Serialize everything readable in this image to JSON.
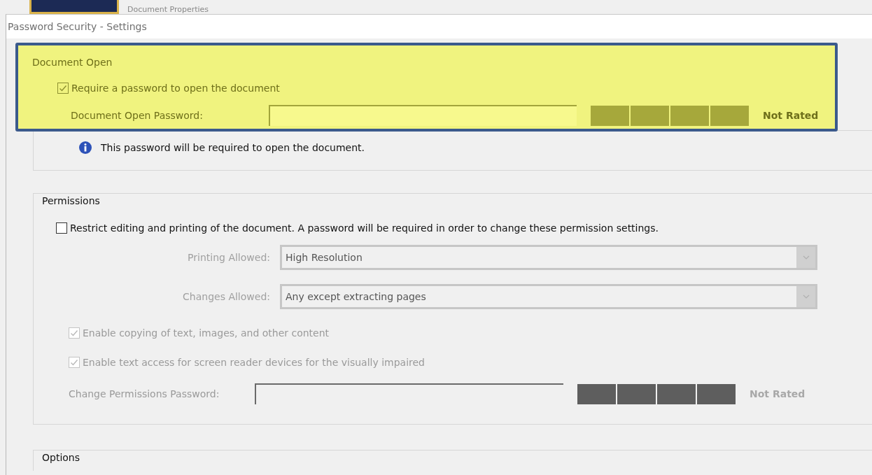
{
  "background_window": {
    "title": "Document Properties"
  },
  "dialog": {
    "title": "Password Security - Settings"
  },
  "document_open": {
    "heading": "Document Open",
    "highlighted": true,
    "require_password": {
      "label": "Require a password to open the document",
      "checked": true,
      "disabled": false
    },
    "password": {
      "label": "Document Open Password:",
      "rating": "Not Rated",
      "disabled": false
    },
    "info": "This password will be required to open the document."
  },
  "permissions": {
    "heading": "Permissions",
    "restrict": {
      "label": "Restrict editing and printing of the document. A password will be required in order to change these permission settings.",
      "checked": false,
      "disabled": false
    },
    "dropdowns": [
      {
        "label": "Printing Allowed:",
        "value": "High Resolution",
        "disabled": true
      },
      {
        "label": "Changes Allowed:",
        "value": "Any except extracting pages",
        "disabled": true
      }
    ],
    "checkboxes": [
      {
        "label": "Enable copying of text, images, and other content",
        "checked": true,
        "disabled": true
      },
      {
        "label": "Enable text access for screen reader devices for the visually impaired",
        "checked": true,
        "disabled": true
      }
    ],
    "password": {
      "label": "Change Permissions Password:",
      "rating": "Not Rated",
      "disabled": true
    }
  },
  "options": {
    "heading": "Options"
  }
}
